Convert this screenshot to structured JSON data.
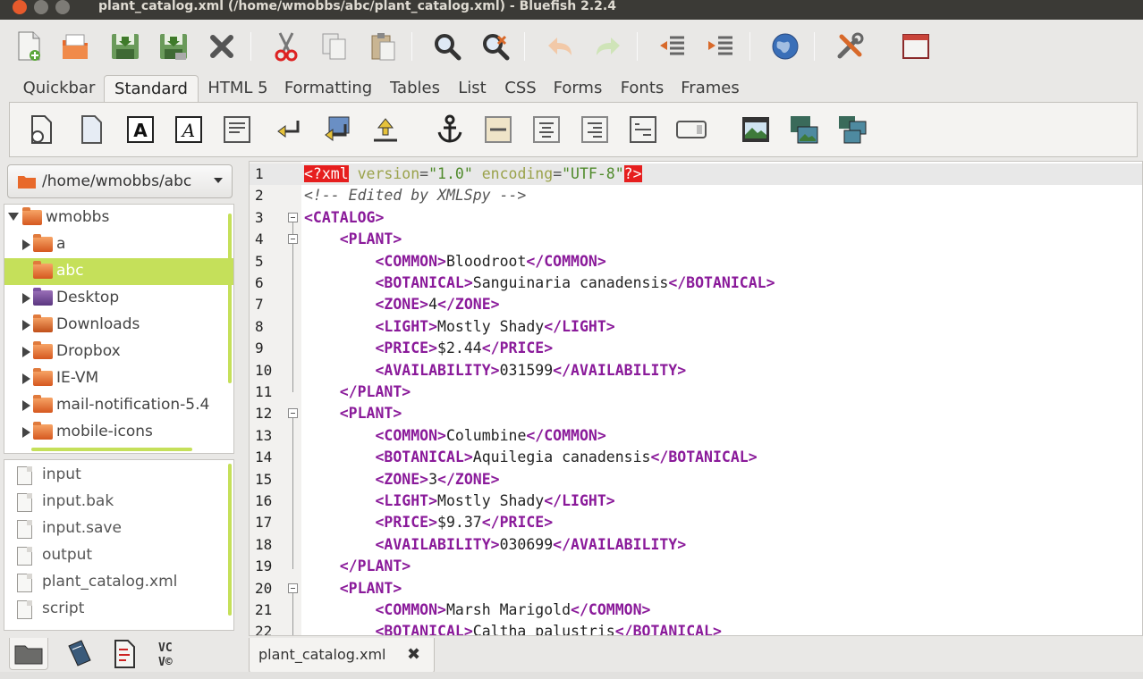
{
  "window": {
    "title": "plant_catalog.xml (/home/wmobbs/abc/plant_catalog.xml) - Bluefish 2.2.4"
  },
  "main_toolbar": {
    "buttons": [
      "new-file-icon",
      "open-file-icon",
      "save-icon",
      "save-as-icon",
      "close-file-icon",
      "cut-icon",
      "copy-icon",
      "paste-icon",
      "find-icon",
      "replace-icon",
      "undo-icon",
      "redo-icon",
      "unindent-icon",
      "indent-icon",
      "preview-browser-icon",
      "preferences-icon",
      "fullscreen-icon"
    ]
  },
  "html_toolbar": {
    "tabs": [
      "Quickbar",
      "Standard",
      "HTML 5",
      "Formatting",
      "Tables",
      "List",
      "CSS",
      "Forms",
      "Fonts",
      "Frames"
    ],
    "active_tab": "Standard",
    "standard_buttons": [
      "quickstart-icon",
      "body-icon",
      "bold-icon",
      "italic-icon",
      "paragraph-icon",
      "break-icon",
      "break-clear-icon",
      "nbsp-icon",
      "anchor-icon",
      "rule-icon",
      "center-icon",
      "right-justify-icon",
      "comment-icon",
      "email-icon",
      "image-icon",
      "thumbnail-icon",
      "multi-thumbnail-icon"
    ]
  },
  "file_browser": {
    "current_dir": "/home/wmobbs/abc",
    "tree": [
      {
        "label": "wmobbs",
        "level": 0,
        "expanded": true,
        "selected": false,
        "kind": "folder"
      },
      {
        "label": "a",
        "level": 1,
        "expanded": false,
        "selected": false,
        "kind": "folder"
      },
      {
        "label": "abc",
        "level": 1,
        "expanded": null,
        "selected": true,
        "kind": "folder"
      },
      {
        "label": "Desktop",
        "level": 1,
        "expanded": false,
        "selected": false,
        "kind": "desktop"
      },
      {
        "label": "Downloads",
        "level": 1,
        "expanded": false,
        "selected": false,
        "kind": "downloads"
      },
      {
        "label": "Dropbox",
        "level": 1,
        "expanded": false,
        "selected": false,
        "kind": "folder"
      },
      {
        "label": "IE-VM",
        "level": 1,
        "expanded": false,
        "selected": false,
        "kind": "folder"
      },
      {
        "label": "mail-notification-5.4",
        "level": 1,
        "expanded": false,
        "selected": false,
        "kind": "folder"
      },
      {
        "label": "mobile-icons",
        "level": 1,
        "expanded": false,
        "selected": false,
        "kind": "folder"
      }
    ],
    "files": [
      "input",
      "input.bak",
      "input.save",
      "output",
      "plant_catalog.xml",
      "script"
    ]
  },
  "side_tabs": [
    "filebrowser-icon",
    "bookmarks-icon",
    "charmap-icon",
    "snippets-icon"
  ],
  "editor": {
    "lines": [
      [
        {
          "c": "pi",
          "t": "<?xml"
        },
        {
          "c": "tx",
          "t": " "
        },
        {
          "c": "at",
          "t": "version"
        },
        {
          "c": "eq",
          "t": "="
        },
        {
          "c": "st",
          "t": "\"1.0\""
        },
        {
          "c": "tx",
          "t": " "
        },
        {
          "c": "at",
          "t": "encoding"
        },
        {
          "c": "eq",
          "t": "="
        },
        {
          "c": "st",
          "t": "\"UTF-8\""
        },
        {
          "c": "pi",
          "t": "?>"
        }
      ],
      [
        {
          "c": "cm",
          "t": "<!-- Edited by XMLSpy -->"
        }
      ],
      [
        {
          "c": "tg",
          "t": "<CATALOG>"
        }
      ],
      [
        {
          "c": "tx",
          "t": "    "
        },
        {
          "c": "tg",
          "t": "<PLANT>"
        }
      ],
      [
        {
          "c": "tx",
          "t": "        "
        },
        {
          "c": "tg",
          "t": "<COMMON>"
        },
        {
          "c": "tx",
          "t": "Bloodroot"
        },
        {
          "c": "tg",
          "t": "</COMMON>"
        }
      ],
      [
        {
          "c": "tx",
          "t": "        "
        },
        {
          "c": "tg",
          "t": "<BOTANICAL>"
        },
        {
          "c": "tx",
          "t": "Sanguinaria canadensis"
        },
        {
          "c": "tg",
          "t": "</BOTANICAL>"
        }
      ],
      [
        {
          "c": "tx",
          "t": "        "
        },
        {
          "c": "tg",
          "t": "<ZONE>"
        },
        {
          "c": "tx",
          "t": "4"
        },
        {
          "c": "tg",
          "t": "</ZONE>"
        }
      ],
      [
        {
          "c": "tx",
          "t": "        "
        },
        {
          "c": "tg",
          "t": "<LIGHT>"
        },
        {
          "c": "tx",
          "t": "Mostly Shady"
        },
        {
          "c": "tg",
          "t": "</LIGHT>"
        }
      ],
      [
        {
          "c": "tx",
          "t": "        "
        },
        {
          "c": "tg",
          "t": "<PRICE>"
        },
        {
          "c": "tx",
          "t": "$2.44"
        },
        {
          "c": "tg",
          "t": "</PRICE>"
        }
      ],
      [
        {
          "c": "tx",
          "t": "        "
        },
        {
          "c": "tg",
          "t": "<AVAILABILITY>"
        },
        {
          "c": "tx",
          "t": "031599"
        },
        {
          "c": "tg",
          "t": "</AVAILABILITY>"
        }
      ],
      [
        {
          "c": "tx",
          "t": "    "
        },
        {
          "c": "tg",
          "t": "</PLANT>"
        }
      ],
      [
        {
          "c": "tx",
          "t": "    "
        },
        {
          "c": "tg",
          "t": "<PLANT>"
        }
      ],
      [
        {
          "c": "tx",
          "t": "        "
        },
        {
          "c": "tg",
          "t": "<COMMON>"
        },
        {
          "c": "tx",
          "t": "Columbine"
        },
        {
          "c": "tg",
          "t": "</COMMON>"
        }
      ],
      [
        {
          "c": "tx",
          "t": "        "
        },
        {
          "c": "tg",
          "t": "<BOTANICAL>"
        },
        {
          "c": "tx",
          "t": "Aquilegia canadensis"
        },
        {
          "c": "tg",
          "t": "</BOTANICAL>"
        }
      ],
      [
        {
          "c": "tx",
          "t": "        "
        },
        {
          "c": "tg",
          "t": "<ZONE>"
        },
        {
          "c": "tx",
          "t": "3"
        },
        {
          "c": "tg",
          "t": "</ZONE>"
        }
      ],
      [
        {
          "c": "tx",
          "t": "        "
        },
        {
          "c": "tg",
          "t": "<LIGHT>"
        },
        {
          "c": "tx",
          "t": "Mostly Shady"
        },
        {
          "c": "tg",
          "t": "</LIGHT>"
        }
      ],
      [
        {
          "c": "tx",
          "t": "        "
        },
        {
          "c": "tg",
          "t": "<PRICE>"
        },
        {
          "c": "tx",
          "t": "$9.37"
        },
        {
          "c": "tg",
          "t": "</PRICE>"
        }
      ],
      [
        {
          "c": "tx",
          "t": "        "
        },
        {
          "c": "tg",
          "t": "<AVAILABILITY>"
        },
        {
          "c": "tx",
          "t": "030699"
        },
        {
          "c": "tg",
          "t": "</AVAILABILITY>"
        }
      ],
      [
        {
          "c": "tx",
          "t": "    "
        },
        {
          "c": "tg",
          "t": "</PLANT>"
        }
      ],
      [
        {
          "c": "tx",
          "t": "    "
        },
        {
          "c": "tg",
          "t": "<PLANT>"
        }
      ],
      [
        {
          "c": "tx",
          "t": "        "
        },
        {
          "c": "tg",
          "t": "<COMMON>"
        },
        {
          "c": "tx",
          "t": "Marsh Marigold"
        },
        {
          "c": "tg",
          "t": "</COMMON>"
        }
      ],
      [
        {
          "c": "tx",
          "t": "        "
        },
        {
          "c": "tg",
          "t": "<BOTANICAL>"
        },
        {
          "c": "tx",
          "t": "Caltha palustris"
        },
        {
          "c": "tg",
          "t": "</BOTANICAL>"
        }
      ]
    ],
    "folds": [
      3,
      4,
      12,
      20
    ],
    "current_line": 1
  },
  "document_tabs": [
    {
      "label": "plant_catalog.xml",
      "close": "✖"
    }
  ],
  "colors": {
    "accent": "#c5e05a",
    "tag": "#8a1a9a",
    "processing_instruction_bg": "#e61e1e",
    "attribute": "#9aa24a",
    "string": "#4f8a2b"
  }
}
